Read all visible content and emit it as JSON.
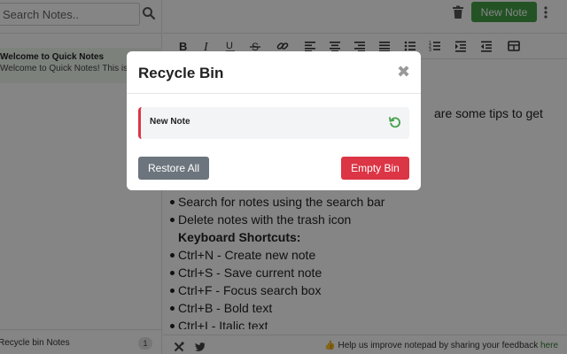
{
  "sidebar": {
    "search_placeholder": "Search Notes..",
    "search_icon": "search-icon",
    "notes": [
      {
        "title": "Welcome to Quick Notes",
        "preview": "Welcome to Quick Notes! This is"
      }
    ],
    "recycle_label": "Recycle bin Notes",
    "recycle_count": "1"
  },
  "header": {
    "trash_icon": "trash-icon",
    "new_note_label": "New Note",
    "more_icon": "more-vertical-icon",
    "accent_color": "#43a047"
  },
  "toolbar": {
    "buttons": [
      "bold",
      "italic",
      "underline",
      "strikethrough",
      "link",
      "align-left",
      "align-center",
      "align-right",
      "align-justify",
      "bulleted-list",
      "numbered-list",
      "indent",
      "outdent",
      "table"
    ]
  },
  "editor": {
    "intro_tail": "are some tips to get",
    "list_items_1": [
      "Search for notes using the search bar",
      "Delete notes with the trash icon"
    ],
    "shortcuts_heading": "Keyboard Shortcuts:",
    "list_items_2": [
      "Ctrl+N - Create new note",
      "Ctrl+S - Save current note",
      "Ctrl+F - Focus search box",
      "Ctrl+B - Bold text",
      "Ctrl+I - Italic text"
    ]
  },
  "status": {
    "feedback_text": "👍 Help us improve notepad by sharing your feedback ",
    "feedback_link": "here"
  },
  "modal": {
    "title": "Recycle Bin",
    "close_symbol": "✖",
    "items": [
      {
        "title": "New Note"
      }
    ],
    "restore_all_label": "Restore All",
    "empty_bin_label": "Empty Bin",
    "danger_color": "#dc3545",
    "success_color": "#43a047"
  }
}
